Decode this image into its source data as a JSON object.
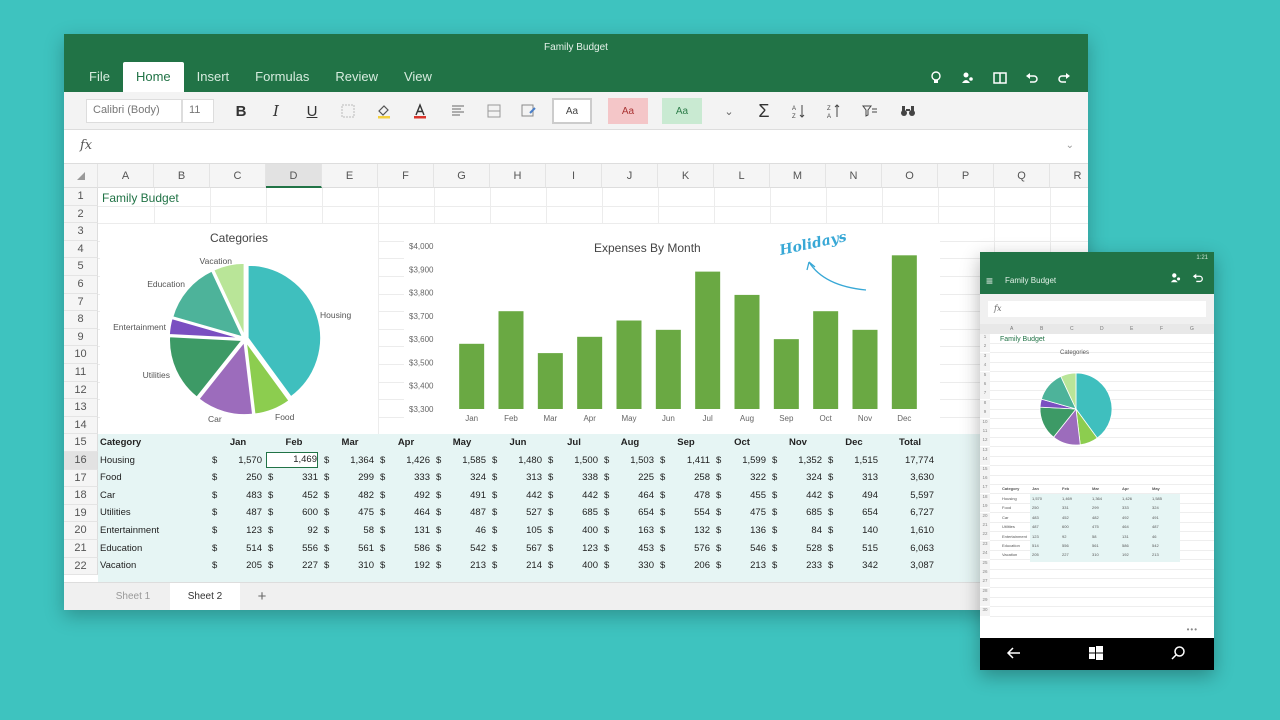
{
  "window": {
    "title": "Family Budget"
  },
  "tabs": [
    "File",
    "Home",
    "Insert",
    "Formulas",
    "Review",
    "View"
  ],
  "ribbon": {
    "font": "Calibri (Body)",
    "size": "11",
    "bold": "B",
    "italic": "I",
    "underline": "U",
    "style1": "Aa",
    "style2": "Aa",
    "style3": "Aa",
    "sigma": "Σ"
  },
  "formula_bar": {
    "fx": "fx"
  },
  "columns": [
    "A",
    "B",
    "C",
    "D",
    "E",
    "F",
    "G",
    "H",
    "I",
    "J",
    "K",
    "L",
    "M",
    "N",
    "O",
    "P",
    "Q",
    "R"
  ],
  "rows": [
    "1",
    "2",
    "3",
    "4",
    "5",
    "6",
    "7",
    "8",
    "9",
    "10",
    "11",
    "12",
    "13",
    "14",
    "15",
    "16",
    "17",
    "18",
    "19",
    "20",
    "21",
    "22"
  ],
  "sheet_title": "Family Budget",
  "pie": {
    "title": "Categories",
    "slices": [
      {
        "label": "Housing",
        "value": 17774,
        "color": "#3fbfbe"
      },
      {
        "label": "Food",
        "value": 3630,
        "color": "#8ccd4f"
      },
      {
        "label": "Car",
        "value": 5597,
        "color": "#9c6cbc"
      },
      {
        "label": "Utilities",
        "value": 6727,
        "color": "#3d9a66"
      },
      {
        "label": "Entertainment",
        "value": 1610,
        "color": "#7a4fc1"
      },
      {
        "label": "Education",
        "value": 6063,
        "color": "#4db39a"
      },
      {
        "label": "Vacation",
        "value": 3087,
        "color": "#b9e598"
      }
    ]
  },
  "bar": {
    "title": "Expenses By Month",
    "annotation": "Holidays",
    "categories": [
      "Jan",
      "Feb",
      "Mar",
      "Apr",
      "May",
      "Jun",
      "Jul",
      "Aug",
      "Sep",
      "Oct",
      "Nov",
      "Dec"
    ],
    "values": [
      3580,
      3720,
      3540,
      3610,
      3680,
      3640,
      3890,
      3790,
      3600,
      3720,
      3640,
      3960
    ],
    "yticks": [
      "$4,000",
      "$3,900",
      "$3,800",
      "$3,700",
      "$3,600",
      "$3,500",
      "$3,400",
      "$3,300"
    ],
    "ylim": [
      3300,
      4000
    ],
    "color": "#6aa943"
  },
  "table": {
    "headers": [
      "Category",
      "Jan",
      "Feb",
      "Mar",
      "Apr",
      "May",
      "Jun",
      "Jul",
      "Aug",
      "Sep",
      "Oct",
      "Nov",
      "Dec",
      "Total"
    ],
    "rows": [
      {
        "num": "16",
        "cells": [
          "Housing",
          "1,570",
          "1,469",
          "1,364",
          "1,426",
          "1,585",
          "1,480",
          "1,500",
          "1,503",
          "1,411",
          "1,599",
          "1,352",
          "1,515",
          "17,774"
        ]
      },
      {
        "num": "17",
        "cells": [
          "Food",
          "250",
          "331",
          "299",
          "333",
          "324",
          "313",
          "338",
          "225",
          "258",
          "322",
          "324",
          "313",
          "3,630"
        ]
      },
      {
        "num": "18",
        "cells": [
          "Car",
          "483",
          "452",
          "482",
          "492",
          "491",
          "442",
          "442",
          "464",
          "478",
          "455",
          "442",
          "494",
          "5,597"
        ]
      },
      {
        "num": "19",
        "cells": [
          "Utilities",
          "487",
          "600",
          "475",
          "464",
          "487",
          "527",
          "685",
          "654",
          "554",
          "475",
          "685",
          "654",
          "6,727"
        ]
      },
      {
        "num": "20",
        "cells": [
          "Entertainment",
          "123",
          "92",
          "58",
          "131",
          "46",
          "105",
          "400",
          "163",
          "132",
          "136",
          "84",
          "140",
          "1,610"
        ]
      },
      {
        "num": "21",
        "cells": [
          "Education",
          "514",
          "556",
          "561",
          "586",
          "542",
          "567",
          "123",
          "453",
          "576",
          "546",
          "528",
          "515",
          "6,063"
        ]
      },
      {
        "num": "22",
        "cells": [
          "Vacation",
          "205",
          "227",
          "310",
          "192",
          "213",
          "214",
          "400",
          "330",
          "206",
          "213",
          "233",
          "342",
          "3,087"
        ]
      }
    ],
    "currency": "$"
  },
  "sheets": [
    "Sheet 1",
    "Sheet 2"
  ],
  "sheet_add": "+",
  "phone": {
    "time": "1:21",
    "title": "Family Budget",
    "fx": "fx",
    "pie_title": "Categories",
    "sheet_title": "Family Budget",
    "headers": [
      "Category",
      "Jan",
      "Feb",
      "Mar",
      "Apr",
      "May"
    ],
    "more": "•••"
  }
}
